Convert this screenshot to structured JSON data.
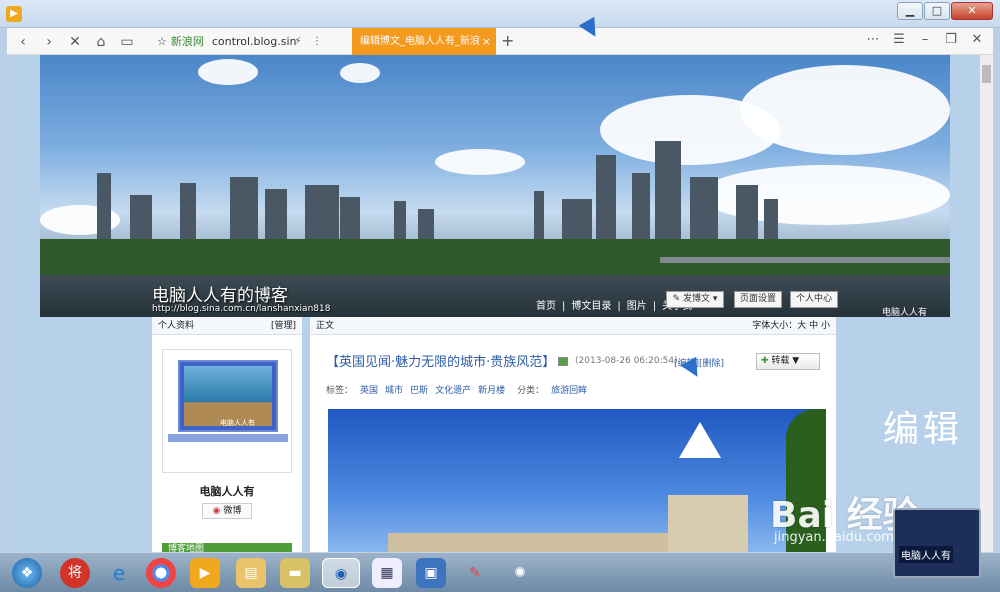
{
  "browser": {
    "site_label": "新浪网",
    "url": "control.blog.sin",
    "tab_title": "编辑博文_电脑人人有_新浪",
    "tab_close": "×",
    "new_tab": "+"
  },
  "banner": {
    "blog_title": "电脑人人有的博客",
    "blog_url": "http://blog.sina.com.cn/lanshanxian818",
    "nav": [
      "首页",
      "|",
      "博文目录",
      "|",
      "图片",
      "|",
      "关于我"
    ],
    "post_button": "发博文",
    "page_settings": "页面设置",
    "personal_center": "个人中心",
    "watermark": "电脑人人有"
  },
  "sidebar": {
    "header": "个人资料",
    "manage": "[管理]",
    "avatar_caption": "电脑人人有",
    "profile_name": "电脑人人有",
    "weibo": "微博",
    "green_bar": "博客地图"
  },
  "main": {
    "header": "正文",
    "font_size": "字体大小：大 中 小",
    "post_title": "【英国见闻·魅力无限的城市·贵族风范】",
    "post_date": "(2013-08-26 06:20:54)",
    "post_edit": "[编辑][删除]",
    "forward": "转载",
    "tags_label": "标签：",
    "tags": [
      "英国",
      "城市",
      "巴斯",
      "文化遗产",
      "新月楼"
    ],
    "category_label": "分类：",
    "category": "旅游回眸"
  },
  "overlay": {
    "edit_text": "编辑",
    "baidu": "Bai 经验",
    "baidu_url": "jingyan.baidu.com",
    "corner_laptop_text": "电脑人人有"
  },
  "colors": {
    "accent_tab": "#f49a1e",
    "link": "#2b5ca8"
  }
}
